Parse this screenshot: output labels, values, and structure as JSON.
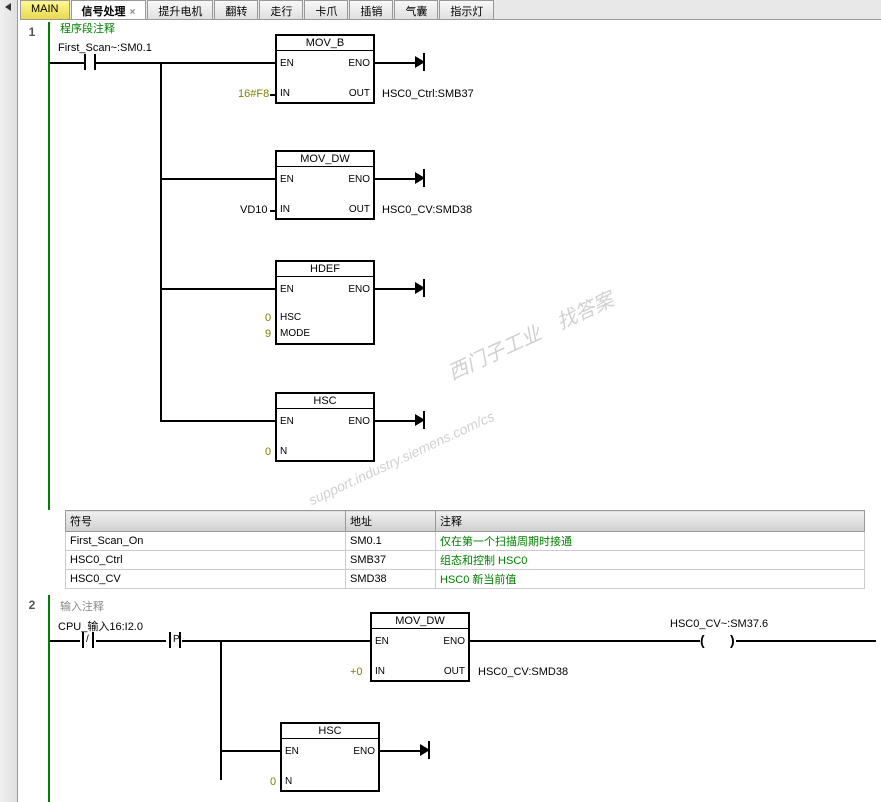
{
  "tabs": [
    {
      "label": "MAIN",
      "type": "main"
    },
    {
      "label": "信号处理",
      "type": "active"
    },
    {
      "label": "提升电机",
      "type": "normal"
    },
    {
      "label": "翻转",
      "type": "normal"
    },
    {
      "label": "走行",
      "type": "normal"
    },
    {
      "label": "卡爪",
      "type": "normal"
    },
    {
      "label": "插销",
      "type": "normal"
    },
    {
      "label": "气囊",
      "type": "normal"
    },
    {
      "label": "指示灯",
      "type": "normal"
    }
  ],
  "network1": {
    "num": "1",
    "title": "程序段注释",
    "input_label": "First_Scan~:SM0.1",
    "blocks": [
      {
        "title": "MOV_B",
        "in_val": "16#F8",
        "out_val": "HSC0_Ctrl:SMB37"
      },
      {
        "title": "MOV_DW",
        "in_val": "VD10",
        "out_val": "HSC0_CV:SMD38"
      },
      {
        "title": "HDEF",
        "hsc_val": "0",
        "mode_val": "9"
      },
      {
        "title": "HSC",
        "n_val": "0"
      }
    ]
  },
  "symbol_table": {
    "headers": [
      "符号",
      "地址",
      "注释"
    ],
    "rows": [
      {
        "sym": "First_Scan_On",
        "addr": "SM0.1",
        "comment": "仅在第一个扫描周期时接通"
      },
      {
        "sym": "HSC0_Ctrl",
        "addr": "SMB37",
        "comment": "组态和控制 HSC0"
      },
      {
        "sym": "HSC0_CV",
        "addr": "SMD38",
        "comment": "HSC0 新当前值"
      }
    ]
  },
  "network2": {
    "num": "2",
    "comment": "输入注释",
    "input_label": "CPU_输入16:I2.0",
    "contact_not": "/",
    "contact_p": "P",
    "output_label": "HSC0_CV~:SM37.6",
    "blocks": [
      {
        "title": "MOV_DW",
        "in_val": "+0",
        "out_val": "HSC0_CV:SMD38"
      },
      {
        "title": "HSC",
        "n_val": "0"
      }
    ]
  },
  "watermarks": {
    "line1": "西门子工业　找答案",
    "line2": "support.industry.siemens.com/cs"
  },
  "block_labels": {
    "en": "EN",
    "eno": "ENO",
    "in": "IN",
    "out": "OUT",
    "hsc": "HSC",
    "mode": "MODE",
    "n": "N"
  }
}
